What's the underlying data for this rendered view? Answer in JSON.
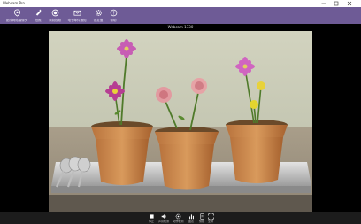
{
  "app": {
    "title": "Webcam Pro"
  },
  "video": {
    "title": "Webcam 1730"
  },
  "toolbar": {
    "items": [
      {
        "label": "更改网络摄像头",
        "icon": "camera-switch-icon"
      },
      {
        "label": "拍照",
        "icon": "photo-icon"
      },
      {
        "label": "录制视频",
        "icon": "record-icon"
      },
      {
        "label": "电子邮件通知",
        "icon": "email-icon"
      },
      {
        "label": "设定值",
        "icon": "settings-icon"
      },
      {
        "label": "帮助",
        "icon": "help-icon"
      }
    ]
  },
  "controls": {
    "items": [
      {
        "label": "停止",
        "icon": "stop-icon"
      },
      {
        "label": "声音检测",
        "icon": "volume-icon"
      },
      {
        "label": "动作检测",
        "icon": "motion-icon"
      },
      {
        "label": "图表",
        "icon": "chart-icon"
      },
      {
        "label": "快照",
        "icon": "snapshot-icon"
      },
      {
        "label": "全屏",
        "icon": "fullscreen-icon"
      }
    ]
  },
  "colors": {
    "toolbar": "#6e5b96",
    "control_bar": "#1c1c1c"
  }
}
